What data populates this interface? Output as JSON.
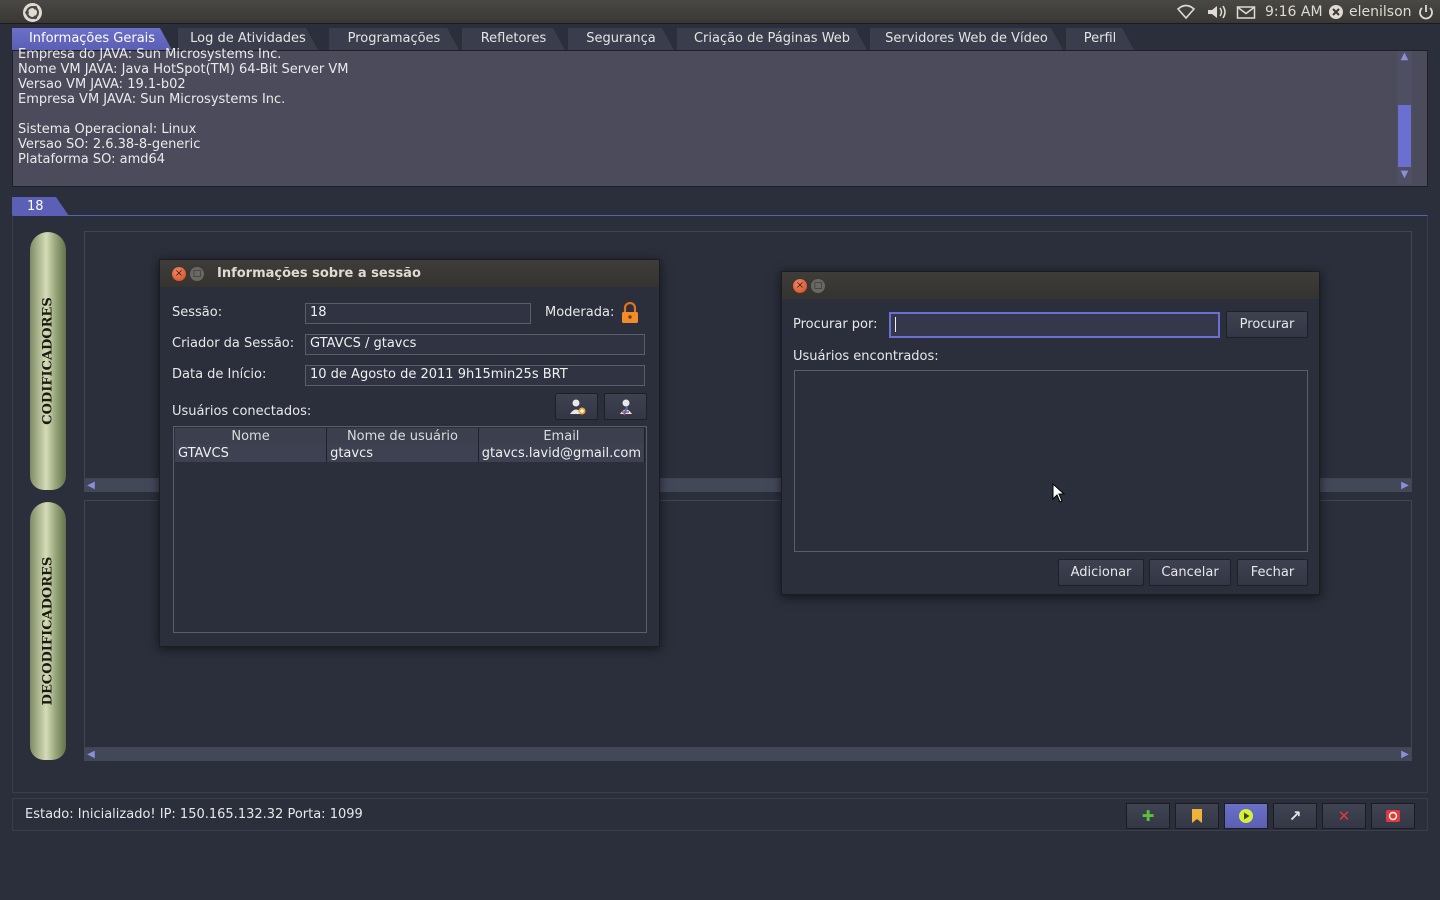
{
  "top_panel": {
    "clock": "9:16 AM",
    "user": "elenilson",
    "icons": [
      "ubuntu-logo",
      "wifi-icon",
      "volume-icon",
      "mail-icon",
      "status-x-icon",
      "power-icon"
    ]
  },
  "tabs": [
    "Informações Gerais",
    "Log de Atividades",
    "Programações",
    "Refletores",
    "Segurança",
    "Criação de Páginas Web",
    "Servidores Web de Vídeo",
    "Perfil"
  ],
  "info_lines": [
    "Empresa do JAVA: Sun Microsystems Inc.",
    "Nome VM JAVA: Java HotSpot(TM) 64-Bit Server VM",
    "Versao VM JAVA: 19.1-b02",
    "Empresa VM JAVA: Sun Microsystems Inc.",
    "",
    "Sistema Operacional: Linux",
    "Versao SO: 2.6.38-8-generic",
    "Plataforma SO: amd64"
  ],
  "session_tab": "18",
  "side_labels": {
    "top": "CODIFICADORES",
    "bottom": "DECODIFICADORES"
  },
  "session_dialog": {
    "title": "Informações sobre a sessão",
    "session_label": "Sessão:",
    "session_value": "18",
    "moderated_label": "Moderada:",
    "creator_label": "Criador da Sessão:",
    "creator_value": "GTAVCS / gtavcs",
    "start_label": "Data de Início:",
    "start_value": "10 de Agosto de 2011 9h15min25s BRT",
    "connected_label": "Usuários conectados:",
    "columns": [
      "Nome",
      "Nome de usuário",
      "Email"
    ],
    "rows": [
      [
        "GTAVCS",
        "gtavcs",
        "gtavcs.lavid@gmail.com"
      ]
    ]
  },
  "search_dialog": {
    "search_label": "Procurar por:",
    "search_value": "",
    "search_button": "Procurar",
    "found_label": "Usuários encontrados:",
    "add_button": "Adicionar",
    "cancel_button": "Cancelar",
    "close_button": "Fechar"
  },
  "status": {
    "text": "Estado:  Inicializado!  IP:  150.165.132.32  Porta:  1099"
  },
  "colors": {
    "accent": "#5b5fb5",
    "background": "#2b2f3b",
    "close": "#d1471f"
  }
}
